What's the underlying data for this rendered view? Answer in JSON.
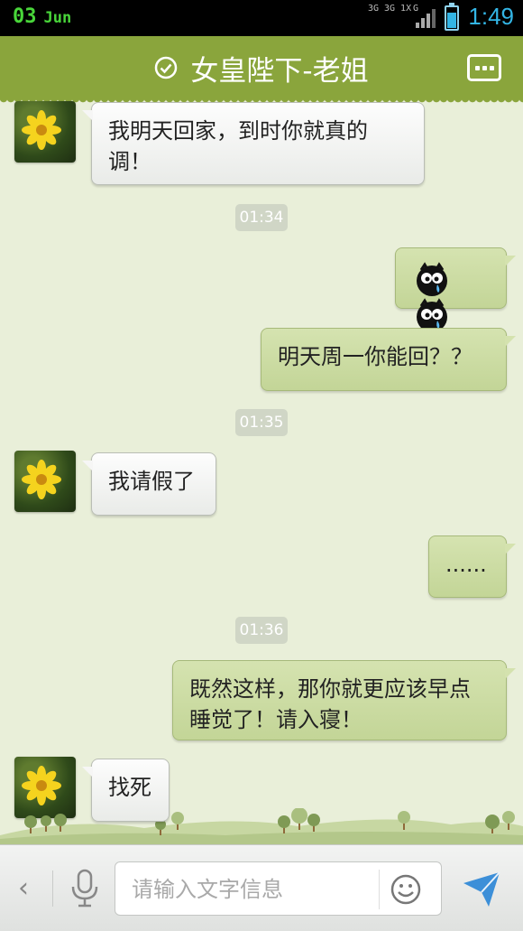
{
  "status_bar": {
    "day": "03",
    "month": "Jun",
    "net_1": "3G",
    "net_2": "3G 1X",
    "net_3": "G",
    "time": "1:49"
  },
  "header": {
    "title": "女皇陛下-老姐",
    "icons": [
      "check-circle-icon",
      "more-menu-icon"
    ]
  },
  "messages": [
    {
      "side": "in",
      "text": "我明天回家，到时你就真的调！"
    },
    {
      "timestamp": "01:34"
    },
    {
      "side": "out",
      "emoji": [
        "crying-face-emoji",
        "crying-face-emoji"
      ]
    },
    {
      "side": "out",
      "text": "明天周一你能回？？"
    },
    {
      "timestamp": "01:35"
    },
    {
      "side": "in",
      "text": "我请假了"
    },
    {
      "side": "out",
      "text": "......"
    },
    {
      "timestamp": "01:36"
    },
    {
      "side": "out",
      "text": "既然这样，那你就更应该早点睡觉了！请入寝！"
    },
    {
      "side": "in",
      "text": "找死"
    }
  ],
  "m": {
    "m1": "我明天回家，到时你就真的调！",
    "t1": "01:34",
    "m3": "明天周一你能回？？",
    "t2": "01:35",
    "m4": "我请假了",
    "m5": "......",
    "t3": "01:36",
    "m6": "既然这样，那你就更应该早点睡觉了！请入寝！",
    "m7": "找死"
  },
  "composer": {
    "back_label": "‹",
    "placeholder": "请输入文字信息",
    "icons": [
      "microphone-icon",
      "smiley-icon",
      "send-icon"
    ]
  },
  "colors": {
    "header": "#8aa53c",
    "background": "#e9efd9",
    "outgoing_bubble": "#c9da9f",
    "incoming_bubble": "#f4f5f3",
    "accent_blue": "#33b5e5"
  }
}
